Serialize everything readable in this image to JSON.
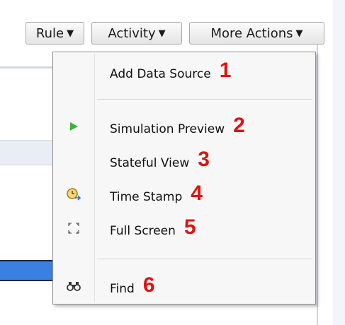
{
  "toolbar": {
    "rule_label": "Rule",
    "activity_label": "Activity",
    "more_actions_label": "More Actions",
    "arrow": "▼"
  },
  "menu": {
    "items": [
      {
        "label": "Add Data Source",
        "number": "1",
        "icon": ""
      },
      {
        "label": "Simulation Preview",
        "number": "2",
        "icon": "play-icon"
      },
      {
        "label": "Stateful View",
        "number": "3",
        "icon": ""
      },
      {
        "label": "Time Stamp",
        "number": "4",
        "icon": "clock-icon"
      },
      {
        "label": "Full Screen",
        "number": "5",
        "icon": "fullscreen-icon"
      },
      {
        "label": "Find",
        "number": "6",
        "icon": "binoculars-icon"
      }
    ],
    "colors": {
      "number_color": "#e01212",
      "play_icon_color": "#3cb23c"
    }
  }
}
